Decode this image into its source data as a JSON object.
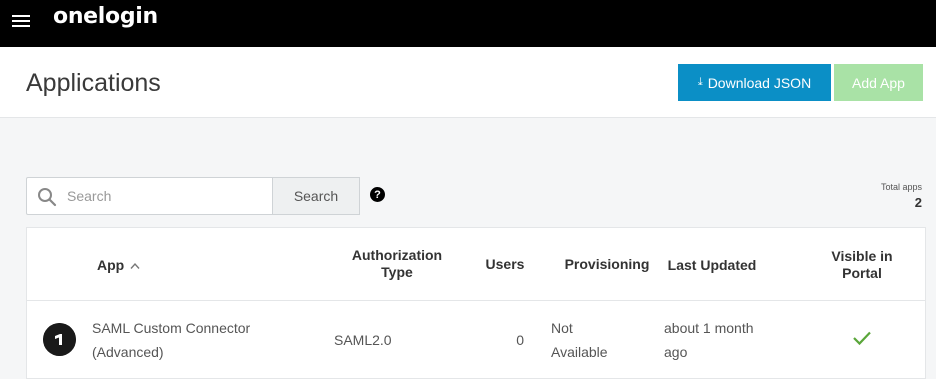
{
  "brand": {
    "logo_text": "onelogin"
  },
  "header": {
    "title": "Applications",
    "download_label": "Download JSON",
    "add_label": "Add App"
  },
  "search": {
    "placeholder": "Search",
    "button_label": "Search",
    "help_label": "?"
  },
  "summary": {
    "total_label": "Total apps",
    "total_value": "2"
  },
  "table": {
    "columns": {
      "app": "App",
      "auth_line1": "Authorization",
      "auth_line2": "Type",
      "users": "Users",
      "provisioning": "Provisioning",
      "last_updated": "Last Updated",
      "visible_line1": "Visible in",
      "visible_line2": "Portal"
    },
    "rows": [
      {
        "name_line1": "SAML Custom Connector",
        "name_line2": "(Advanced)",
        "auth_type": "SAML2.0",
        "users": "0",
        "prov_line1": "Not",
        "prov_line2": "Available",
        "updated_line1": "about 1 month",
        "updated_line2": "ago",
        "visible_in_portal": true
      }
    ]
  },
  "colors": {
    "topbar": "#000000",
    "primary": "#0b8fc6",
    "add_disabled": "#a9e2a6",
    "check": "#5aa63a"
  }
}
